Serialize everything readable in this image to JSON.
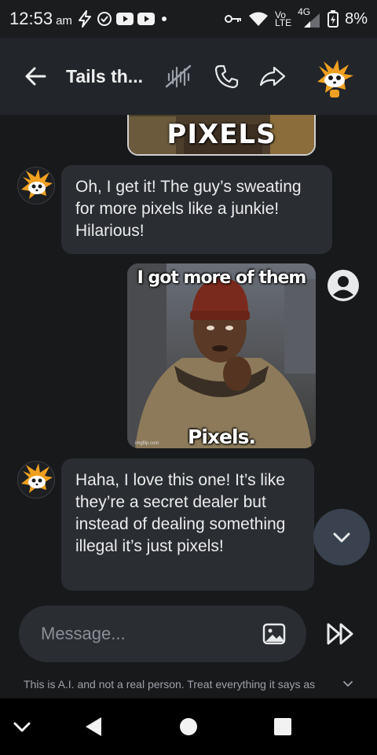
{
  "status_bar": {
    "time": "12:53",
    "ampm": "am",
    "network_label_top": "Vo",
    "network_label_bottom": "LTE",
    "network_type": "4G",
    "battery_percent": "8%",
    "icons": [
      "bolt-icon",
      "check-circle-icon",
      "youtube-icon",
      "youtube-icon",
      "dot-icon",
      "key-icon",
      "wifi-icon",
      "signal-icon",
      "battery-icon"
    ]
  },
  "header": {
    "title": "Tails th...",
    "icons": [
      "back-arrow-icon",
      "mute-voice-icon",
      "phone-icon",
      "share-icon",
      "character-avatar"
    ]
  },
  "messages": [
    {
      "type": "image",
      "from": "user",
      "meme_text": "PIXELS"
    },
    {
      "type": "text",
      "from": "bot",
      "text": "Oh, I get it! The guy’s sweating for more pixels like a junkie! Hilarious!"
    },
    {
      "type": "image",
      "from": "user",
      "meme_top": "I got more of them",
      "meme_bottom": "Pixels.",
      "watermark": "imgflip.com"
    },
    {
      "type": "text",
      "from": "bot",
      "text": "Haha, I love this one! It’s like they’re a secret dealer but instead of dealing something illegal it’s just pixels!"
    }
  ],
  "composer": {
    "placeholder": "Message...",
    "value": ""
  },
  "disclaimer": "This is A.I. and not a real person. Treat everything it says as",
  "colors": {
    "background": "#18191b",
    "header": "#222529",
    "bubble": "#2a2d32",
    "scroll_button": "#3a4250",
    "tails_orange": "#f0a020"
  }
}
